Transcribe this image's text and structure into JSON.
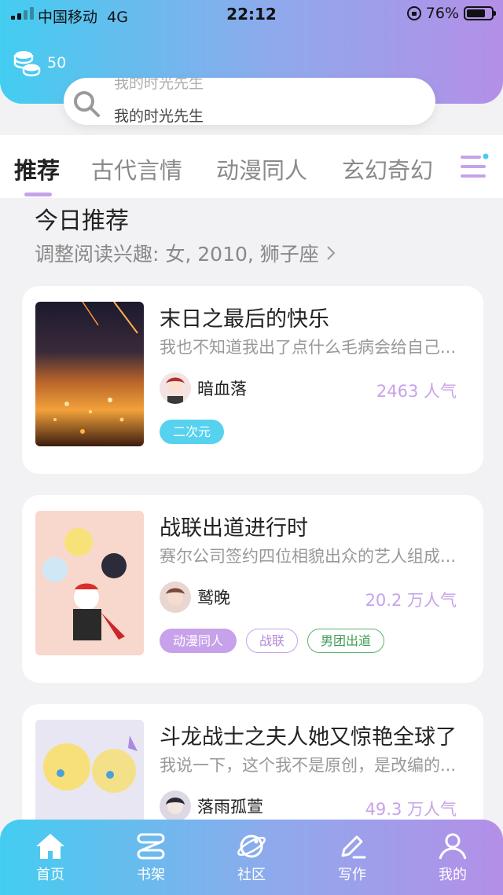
{
  "status_bar": {
    "carrier": "中国移动",
    "network": "4G",
    "time": "22:12",
    "battery": "76%",
    "battery_level": 0.76
  },
  "header": {
    "coins": "50"
  },
  "search": {
    "placeholder_prev": "我的时光先生",
    "placeholder": "我的时光先生"
  },
  "tabs": [
    {
      "label": "推荐",
      "active": true
    },
    {
      "label": "古代言情"
    },
    {
      "label": "动漫同人"
    },
    {
      "label": "玄幻奇幻"
    }
  ],
  "section": {
    "title": "今日推荐",
    "subtitle": "调整阅读兴趣: 女, 2010, 狮子座"
  },
  "books": [
    {
      "title": "末日之最后的快乐",
      "desc": "我也不知道我出了点什么毛病会给自己...",
      "author": "暗血落",
      "popularity": "2463 人气",
      "tags": [
        "二次元"
      ]
    },
    {
      "title": "战联出道进行时",
      "desc": "赛尔公司签约四位相貌出众的艺人组成...",
      "author": "鹫晚",
      "popularity": "20.2 万人气",
      "tags": [
        "动漫同人",
        "战联",
        "男团出道"
      ]
    },
    {
      "title": "斗龙战士之夫人她又惊艳全球了",
      "desc": "我说一下，这个我不是原创，是改编的...",
      "author": "落雨孤萱",
      "popularity": "49.3 万人气",
      "tags": []
    }
  ],
  "bottom_nav": [
    {
      "label": "首页",
      "icon": "home-icon",
      "active": true
    },
    {
      "label": "书架",
      "icon": "bookshelf-icon"
    },
    {
      "label": "社区",
      "icon": "planet-icon"
    },
    {
      "label": "写作",
      "icon": "pen-icon"
    },
    {
      "label": "我的",
      "icon": "user-icon"
    }
  ],
  "colors": {
    "accent": "#c7a2ea",
    "cyan": "#56d2ef",
    "gradient_start": "#43cdf0",
    "gradient_end": "#b48fe8"
  }
}
